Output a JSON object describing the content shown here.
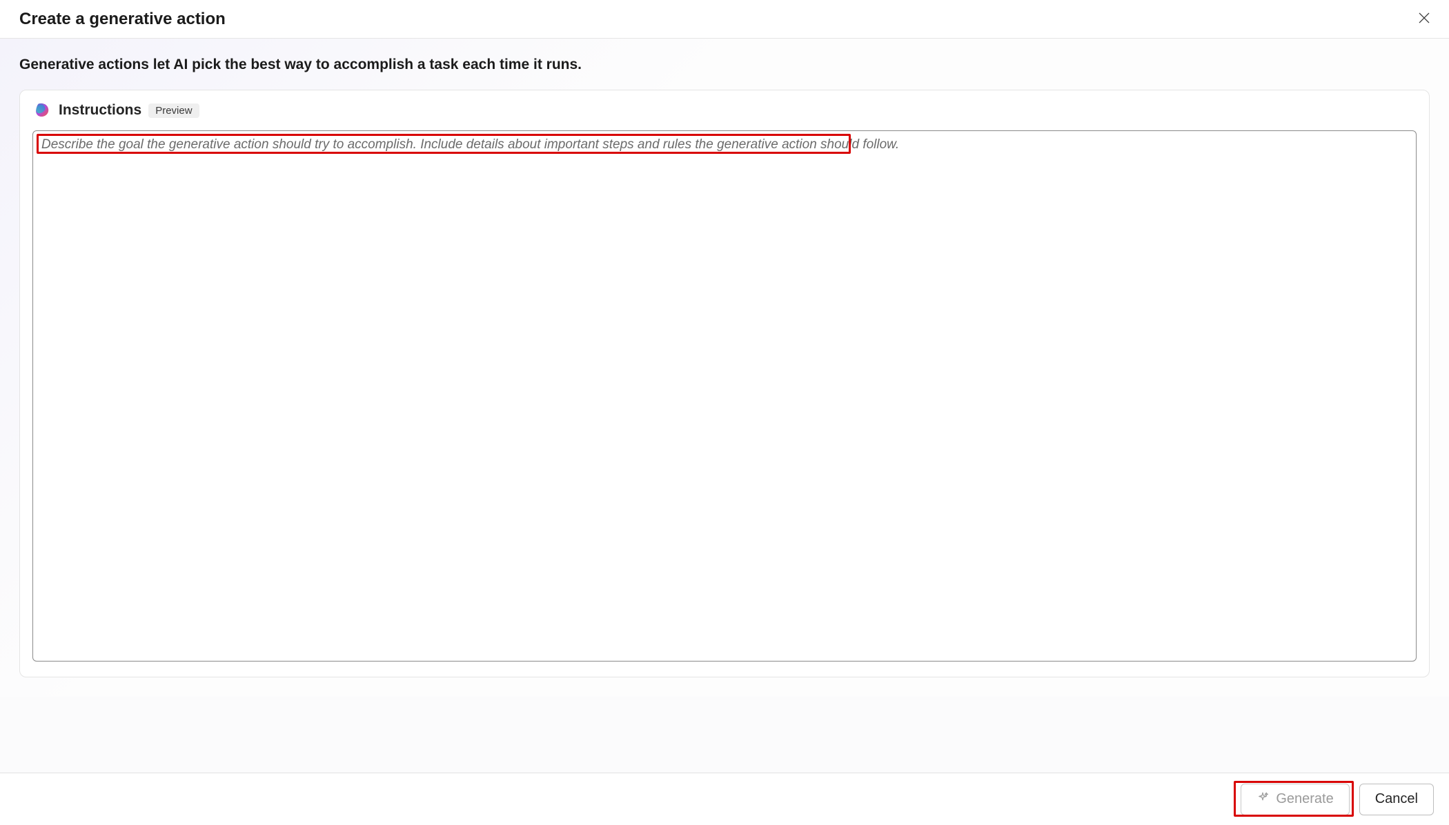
{
  "dialog": {
    "title": "Create a generative action",
    "lead": "Generative actions let AI pick the best way to accomplish a task each time it runs."
  },
  "instructions": {
    "section_label": "Instructions",
    "preview_badge": "Preview",
    "placeholder": "Describe the goal the generative action should try to accomplish. Include details about important steps and rules the generative action should follow.",
    "value": ""
  },
  "actions": {
    "generate_label": "Generate",
    "cancel_label": "Cancel"
  }
}
